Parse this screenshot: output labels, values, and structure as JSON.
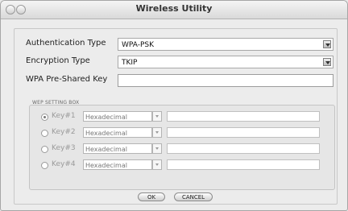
{
  "window": {
    "title": "Wireless Utility"
  },
  "form": {
    "auth_label": "Authentication Type",
    "auth_value": "WPA-PSK",
    "enc_label": "Encryption Type",
    "enc_value": "TKIP",
    "psk_label": "WPA Pre-Shared Key",
    "psk_value": ""
  },
  "wep": {
    "title": "WEP SETTING BOX",
    "keys": [
      {
        "label": "Key#1",
        "format": "Hexadecimal",
        "selected": true
      },
      {
        "label": "Key#2",
        "format": "Hexadecimal",
        "selected": false
      },
      {
        "label": "Key#3",
        "format": "Hexadecimal",
        "selected": false
      },
      {
        "label": "Key#4",
        "format": "Hexadecimal",
        "selected": false
      }
    ]
  },
  "buttons": {
    "ok": "OK",
    "cancel": "CANCEL"
  }
}
